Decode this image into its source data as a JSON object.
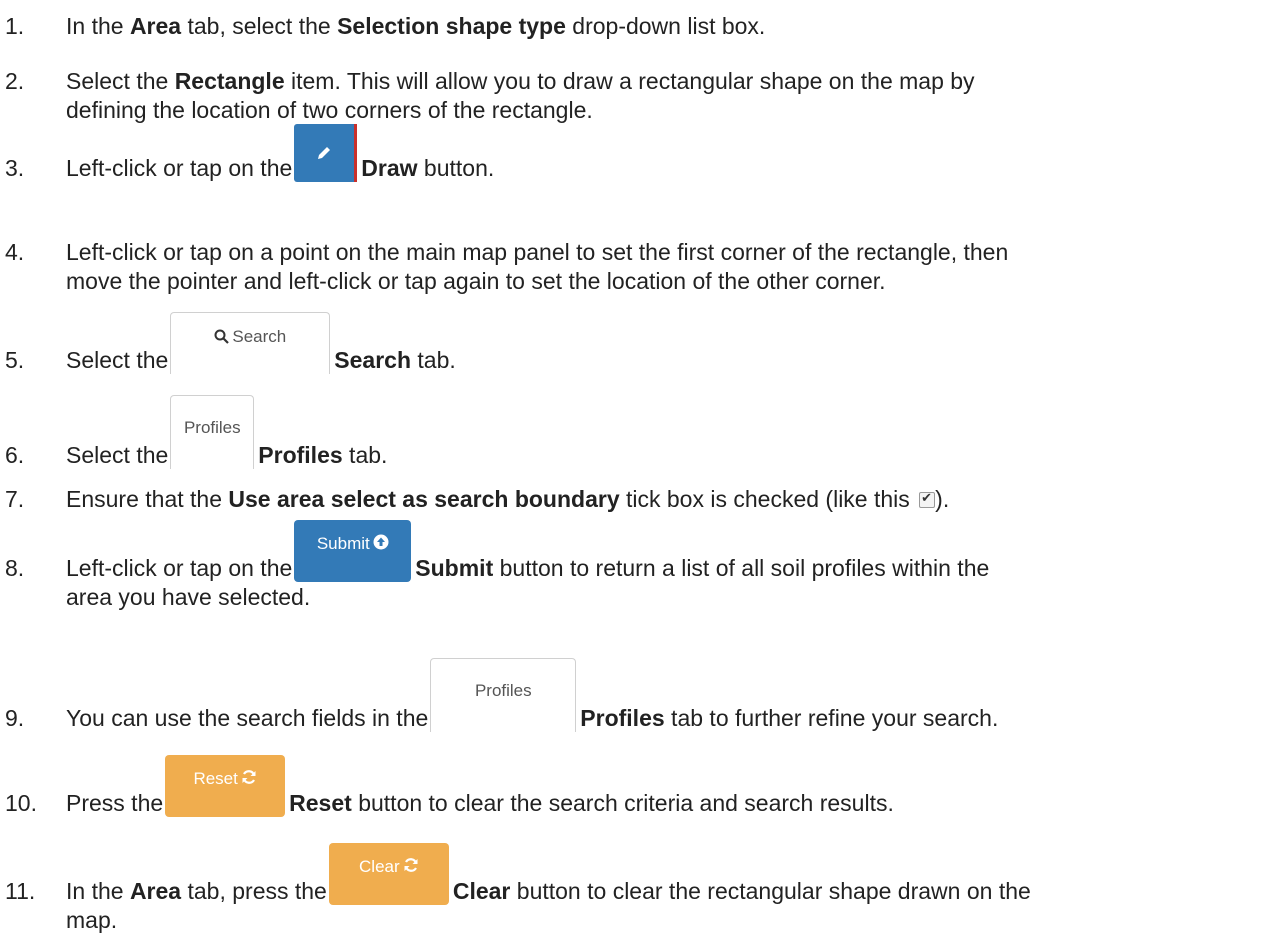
{
  "steps": [
    {
      "num": "1.",
      "a": "In the ",
      "b1": "Area",
      "c": " tab, select the ",
      "b2": "Selection shape type",
      "d": " drop-down list box."
    },
    {
      "num": "2.",
      "a": "Select the ",
      "b1": "Rectangle",
      "c": " item. This will allow you to draw a rectangular shape on the map by",
      "line2": "defining the location of two corners of the rectangle."
    },
    {
      "num": "3.",
      "a": "Left-click or tap on the ",
      "b1": "Draw",
      "c": " button."
    },
    {
      "num": "4.",
      "a": "Left-click or tap on a point on the main map panel to set the first corner of the rectangle, then",
      "line2": "move the pointer and left-click or tap again to set the location of the other corner."
    },
    {
      "num": "5.",
      "a": "Select the ",
      "btn": "Search",
      "b1": "Search",
      "c": " tab."
    },
    {
      "num": "6.",
      "a": "Select the ",
      "btn": "Profiles",
      "b1": "Profiles",
      "c": " tab."
    },
    {
      "num": "7.",
      "a": "Ensure that the ",
      "b1": "Use area select as search boundary",
      "c": " tick box is checked (like this ",
      "d": ")."
    },
    {
      "num": "8.",
      "a": "Left-click or tap on the ",
      "btn": "Submit",
      "b1": "Submit",
      "c": " button to return a list of all soil profiles within the",
      "line2": "area you have selected."
    },
    {
      "num": "9.",
      "a": "You can use the search fields in the ",
      "btn": "Profiles",
      "b1": "Profiles",
      "c": " tab to further refine your search."
    },
    {
      "num": "10.",
      "a": "Press the ",
      "btn": "Reset",
      "b1": "Reset",
      "c": " button to clear the search criteria and search results."
    },
    {
      "num": "11.",
      "a": "In the ",
      "b1": "Area",
      "c": " tab, press the ",
      "btn": "Clear",
      "b2": "Clear",
      "d": " button to clear the rectangular shape drawn on the",
      "line2": "map."
    }
  ],
  "colors": {
    "primary_button": "#337ab7",
    "warning_button": "#f0ad4e"
  },
  "icons": {
    "draw": "pencil-icon",
    "search": "search-icon",
    "submit": "circle-arrow-up-icon",
    "reset": "refresh-icon",
    "clear": "refresh-icon",
    "checkbox": "checked-checkbox-icon"
  }
}
